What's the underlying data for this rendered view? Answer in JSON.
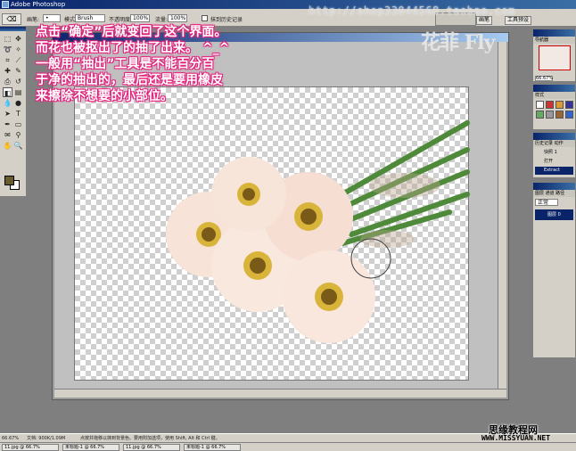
{
  "app": {
    "title": "Adobe Photoshop"
  },
  "options_bar": {
    "brush_label": "画笔:",
    "brush_value": "Brush",
    "mode_label": "模式:",
    "mode_value": "画笔",
    "opacity_label": "不透明度:",
    "opacity_value": "100%",
    "flow_label": "流量:",
    "flow_value": "100%",
    "erase_history_label": "抹到历史记录"
  },
  "watermark": {
    "url": "http://shop33044568.taobao.com",
    "brand": "花菲 Fly"
  },
  "document": {
    "title": "",
    "zoom": "66.67% 文档:"
  },
  "annotations": [
    "点击“确定”后就变回了这个界面。",
    "而花也被抠出了的抽了出来。  ^_^",
    "一般用“抽出”工具是不能百分百",
    "于净的抽出的，最后还是要用橡皮",
    "来擦除不想要的小部位。"
  ],
  "navigator": {
    "zoom": "66.67%"
  },
  "history": {
    "tabs": "历史记录 动作",
    "items": [
      "快照 1",
      "打开",
      "Extract"
    ]
  },
  "layers": {
    "tabs": "图层 通道 路径",
    "mode": "正常",
    "items": [
      "图层 0"
    ]
  },
  "statusbar": {
    "zoom": "66.67%",
    "doc_info": "文档: 900K/1.09M",
    "hint": "点按并拖移以抹到背景色。要用附加选项，使用 Shift, Alt 和 Ctrl 键。"
  },
  "taskbar": {
    "items": [
      "11.jpg @ 66.7%",
      "未标题-1 @ 66.7%",
      "11.jpg @ 66.7%",
      "未标题-1 @ 66.7%"
    ]
  },
  "site_credit": {
    "name": "思缘教程网",
    "url": "WWW.MISSYUAN.NET"
  },
  "colors": {
    "annotation_outline": "#e0207a",
    "accent": "#0a246a",
    "foreground": "#6a5b2c"
  }
}
